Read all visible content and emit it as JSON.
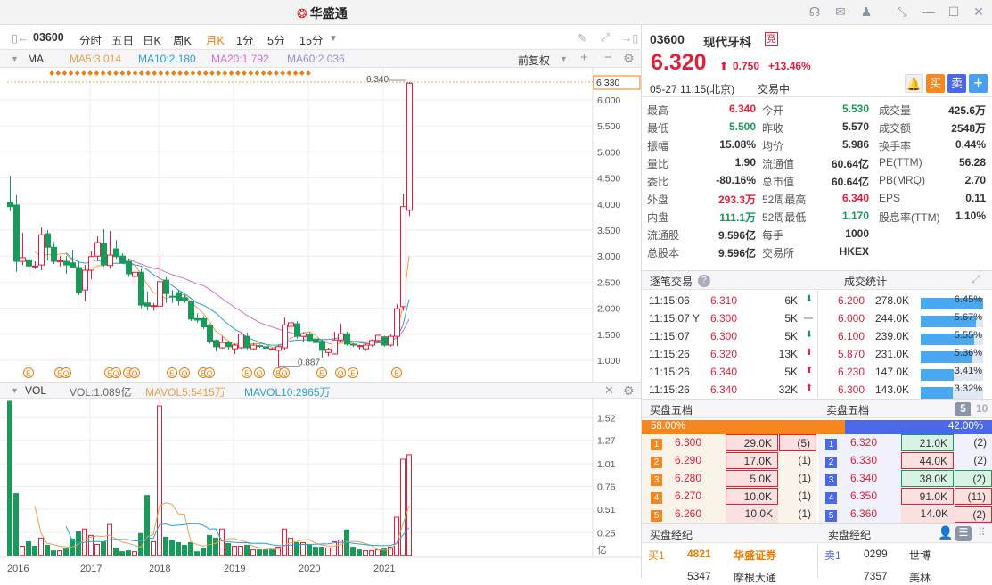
{
  "app": {
    "title": "华盛通"
  },
  "toolbar": {
    "code": "03600",
    "periods": [
      "分时",
      "五日",
      "日K",
      "周K",
      "月K",
      "1分",
      "5分",
      "15分"
    ],
    "active": "月K"
  },
  "ma": {
    "label": "MA",
    "ma5": "MA5:3.014",
    "ma10": "MA10:2.180",
    "ma20": "MA20:1.792",
    "ma60": "MA60:2.036",
    "adjust": "前复权"
  },
  "vol": {
    "label": "VOL",
    "vol": "VOL:1.089亿",
    "mavol5": "MAVOL5:5415万",
    "mavol10": "MAVOL10:2965万"
  },
  "colors": {
    "up": "#e0203a",
    "down": "#1a9a5a",
    "ma5": "#e8a04a",
    "ma10": "#2a9fd6",
    "ma20": "#d070d0",
    "ma60": "#9a8fe0",
    "accent": "#f07c00"
  },
  "chart_data": {
    "type": "candlestick",
    "price_ticks": [
      "6.000",
      "5.500",
      "5.000",
      "4.500",
      "4.000",
      "3.500",
      "3.000",
      "2.500",
      "2.000",
      "1.500",
      "1.000"
    ],
    "price_range": [
      1.0,
      6.0
    ],
    "max_label": "6.340",
    "min_label": "0.887",
    "current_label": "6.330",
    "years": [
      "2016",
      "2017",
      "2018",
      "2019",
      "2020",
      "2021"
    ],
    "year_index": [
      1,
      13,
      24,
      36,
      48,
      60
    ],
    "ohlc": [
      [
        4.03,
        4.54,
        3.86,
        3.95
      ],
      [
        3.98,
        4.17,
        2.7,
        2.9
      ],
      [
        2.9,
        3.45,
        2.83,
        2.97
      ],
      [
        2.93,
        3.14,
        2.64,
        2.81
      ],
      [
        2.81,
        2.9,
        2.75,
        2.81
      ],
      [
        2.83,
        3.55,
        2.73,
        3.41
      ],
      [
        3.43,
        3.5,
        2.92,
        3.17
      ],
      [
        3.17,
        3.27,
        2.85,
        2.9
      ],
      [
        2.89,
        3.0,
        2.8,
        2.91
      ],
      [
        2.9,
        3.0,
        2.66,
        2.83
      ],
      [
        2.87,
        3.12,
        2.78,
        2.78
      ],
      [
        2.78,
        2.9,
        2.25,
        2.3
      ],
      [
        2.35,
        2.83,
        2.13,
        2.73
      ],
      [
        2.73,
        3.09,
        2.56,
        2.99
      ],
      [
        3.0,
        3.38,
        2.9,
        3.26
      ],
      [
        3.24,
        3.52,
        2.8,
        2.83
      ],
      [
        2.82,
        3.48,
        2.76,
        3.02
      ],
      [
        3.14,
        3.31,
        2.95,
        2.99
      ],
      [
        3.0,
        3.05,
        2.85,
        2.87
      ],
      [
        2.9,
        2.95,
        2.6,
        2.66
      ],
      [
        2.61,
        2.69,
        2.44,
        2.69
      ],
      [
        2.69,
        2.75,
        2.0,
        2.06
      ],
      [
        2.1,
        2.32,
        1.96,
        2.04
      ],
      [
        2.04,
        2.1,
        1.95,
        2.05
      ],
      [
        2.04,
        3.02,
        2.0,
        2.51
      ],
      [
        2.54,
        2.6,
        2.1,
        2.28
      ],
      [
        2.23,
        2.35,
        2.1,
        2.22
      ],
      [
        2.3,
        2.35,
        2.05,
        2.15
      ],
      [
        2.2,
        2.25,
        2.1,
        2.15
      ],
      [
        2.13,
        2.15,
        1.75,
        1.79
      ],
      [
        1.8,
        1.9,
        1.72,
        1.77
      ],
      [
        1.8,
        1.85,
        1.6,
        1.64
      ],
      [
        1.67,
        1.7,
        1.32,
        1.36
      ],
      [
        1.38,
        1.4,
        1.17,
        1.26
      ],
      [
        1.24,
        1.46,
        1.22,
        1.34
      ],
      [
        1.34,
        1.38,
        1.2,
        1.26
      ],
      [
        1.22,
        1.32,
        1.12,
        1.29
      ],
      [
        1.24,
        1.52,
        1.22,
        1.5
      ],
      [
        1.46,
        1.53,
        1.21,
        1.24
      ],
      [
        1.22,
        1.33,
        1.2,
        1.29
      ],
      [
        1.28,
        1.3,
        1.24,
        1.27
      ],
      [
        1.26,
        1.28,
        1.2,
        1.23
      ],
      [
        1.22,
        1.24,
        1.2,
        1.22
      ],
      [
        1.19,
        1.3,
        0.887,
        1.26
      ],
      [
        1.24,
        1.82,
        1.2,
        1.68
      ],
      [
        1.65,
        1.75,
        1.5,
        1.72
      ],
      [
        1.7,
        1.75,
        1.42,
        1.46
      ],
      [
        1.46,
        1.54,
        1.35,
        1.51
      ],
      [
        1.5,
        1.54,
        1.36,
        1.38
      ],
      [
        1.41,
        1.45,
        1.32,
        1.34
      ],
      [
        1.36,
        1.4,
        1.05,
        1.19
      ],
      [
        1.15,
        1.24,
        1.08,
        1.21
      ],
      [
        1.12,
        1.55,
        1.12,
        1.39
      ],
      [
        1.39,
        1.7,
        1.34,
        1.51
      ],
      [
        1.51,
        1.55,
        1.28,
        1.31
      ],
      [
        1.31,
        1.33,
        1.26,
        1.29
      ],
      [
        1.28,
        1.3,
        1.21,
        1.28
      ],
      [
        1.22,
        1.32,
        1.18,
        1.29
      ],
      [
        1.29,
        1.4,
        1.26,
        1.38
      ],
      [
        1.38,
        1.49,
        1.34,
        1.48
      ],
      [
        1.45,
        1.47,
        1.26,
        1.29
      ],
      [
        1.29,
        1.5,
        1.26,
        1.46
      ],
      [
        1.46,
        2.08,
        1.27,
        1.99
      ],
      [
        2.03,
        4.2,
        1.95,
        3.95
      ],
      [
        3.88,
        6.34,
        3.77,
        6.32
      ]
    ],
    "markers": [
      [
        3,
        "E"
      ],
      [
        8,
        "E"
      ],
      [
        9,
        "Q"
      ],
      [
        16,
        "E"
      ],
      [
        17,
        "Q"
      ],
      [
        19,
        "E"
      ],
      [
        20,
        "Q"
      ],
      [
        26,
        "E"
      ],
      [
        28,
        "Q"
      ],
      [
        31,
        "E"
      ],
      [
        32,
        "Q"
      ],
      [
        38,
        "E"
      ],
      [
        40,
        "Q"
      ],
      [
        43,
        "E"
      ],
      [
        44,
        "Q"
      ],
      [
        50,
        "E"
      ],
      [
        53,
        "Q"
      ],
      [
        55,
        "E"
      ],
      [
        62,
        "E"
      ]
    ],
    "vol_ticks": [
      "1.52",
      "1.27",
      "1.01",
      "0.76",
      "0.51",
      "0.25"
    ],
    "vol_unit": "亿",
    "volume": [
      [
        1.7,
        0
      ],
      [
        0.68,
        0
      ],
      [
        0.1,
        1
      ],
      [
        0.15,
        0
      ],
      [
        0.1,
        0
      ],
      [
        0.19,
        1
      ],
      [
        0.11,
        0
      ],
      [
        0.05,
        0
      ],
      [
        0.05,
        1
      ],
      [
        0.07,
        0
      ],
      [
        0.18,
        0
      ],
      [
        0.26,
        0
      ],
      [
        0.29,
        1
      ],
      [
        0.22,
        1
      ],
      [
        0.12,
        1
      ],
      [
        0.15,
        0
      ],
      [
        0.34,
        1
      ],
      [
        0.08,
        0
      ],
      [
        0.04,
        0
      ],
      [
        0.05,
        0
      ],
      [
        0.04,
        1
      ],
      [
        0.24,
        0
      ],
      [
        0.66,
        0
      ],
      [
        0.15,
        1
      ],
      [
        1.65,
        1
      ],
      [
        0.2,
        0
      ],
      [
        0.16,
        0
      ],
      [
        0.14,
        0
      ],
      [
        0.11,
        0
      ],
      [
        0.14,
        0
      ],
      [
        0.04,
        0
      ],
      [
        0.08,
        0
      ],
      [
        0.22,
        0
      ],
      [
        0.19,
        0
      ],
      [
        0.29,
        1
      ],
      [
        0.13,
        0
      ],
      [
        0.1,
        1
      ],
      [
        0.1,
        1
      ],
      [
        0.11,
        0
      ],
      [
        0.06,
        1
      ],
      [
        0.06,
        0
      ],
      [
        0.06,
        0
      ],
      [
        0.06,
        0
      ],
      [
        0.09,
        1
      ],
      [
        0.29,
        1
      ],
      [
        0.19,
        1
      ],
      [
        0.14,
        0
      ],
      [
        0.14,
        1
      ],
      [
        0.11,
        0
      ],
      [
        0.09,
        0
      ],
      [
        0.09,
        0
      ],
      [
        0.08,
        1
      ],
      [
        0.15,
        1
      ],
      [
        0.17,
        1
      ],
      [
        0.28,
        0
      ],
      [
        0.09,
        0
      ],
      [
        0.06,
        0
      ],
      [
        0.05,
        1
      ],
      [
        0.05,
        1
      ],
      [
        0.06,
        1
      ],
      [
        0.07,
        0
      ],
      [
        0.09,
        1
      ],
      [
        0.42,
        1
      ],
      [
        1.06,
        1
      ],
      [
        1.11,
        1
      ]
    ]
  },
  "quote": {
    "code": "03600",
    "name": "现代牙科",
    "badge": "竞",
    "price": "6.320",
    "change": "0.750",
    "pct": "+13.46%",
    "time": "05-27  11:15(北京)",
    "status": "交易中",
    "buy": "买",
    "sell": "卖",
    "add": "+"
  },
  "stats": [
    [
      [
        "最高",
        "6.340",
        "red"
      ],
      [
        "今开",
        "5.530",
        "green"
      ],
      [
        "成交量",
        "425.6万",
        ""
      ]
    ],
    [
      [
        "最低",
        "5.500",
        "green"
      ],
      [
        "昨收",
        "5.570",
        ""
      ],
      [
        "成交额",
        "2548万",
        ""
      ]
    ],
    [
      [
        "振幅",
        "15.08%",
        ""
      ],
      [
        "均价",
        "5.986",
        ""
      ],
      [
        "换手率",
        "0.44%",
        ""
      ]
    ],
    [
      [
        "量比",
        "1.90",
        ""
      ],
      [
        "流通值",
        "60.64亿",
        ""
      ],
      [
        "PE(TTM)",
        "56.28",
        ""
      ]
    ],
    [
      [
        "委比",
        "-80.16%",
        ""
      ],
      [
        "总市值",
        "60.64亿",
        ""
      ],
      [
        "PB(MRQ)",
        "2.70",
        ""
      ]
    ],
    [
      [
        "外盘",
        "293.3万",
        "red"
      ],
      [
        "52周最高",
        "6.340",
        "red"
      ],
      [
        "EPS",
        "0.11",
        ""
      ]
    ],
    [
      [
        "内盘",
        "111.1万",
        "green"
      ],
      [
        "52周最低",
        "1.170",
        "green"
      ],
      [
        "股息率(TTM)",
        "1.10%",
        ""
      ]
    ],
    [
      [
        "流通股",
        "9.596亿",
        ""
      ],
      [
        "每手",
        "1000",
        ""
      ]
    ],
    [
      [
        "总股本",
        "9.596亿",
        ""
      ],
      [
        "交易所",
        "HKEX",
        ""
      ]
    ]
  ],
  "trades": {
    "title": "逐笔交易",
    "stats_title": "成交统计",
    "rows": [
      [
        "11:15:06",
        "6.310",
        "6K",
        "down"
      ],
      [
        "11:15:07 Y",
        "6.300",
        "5K",
        "flat"
      ],
      [
        "11:15:07",
        "6.300",
        "5K",
        "down"
      ],
      [
        "11:15:26",
        "6.320",
        "13K",
        "up"
      ],
      [
        "11:15:26",
        "6.340",
        "5K",
        "up"
      ],
      [
        "11:15:26",
        "6.340",
        "32K",
        "up"
      ]
    ],
    "stats": [
      [
        "6.200",
        "278.0K",
        "6.45%",
        6.45
      ],
      [
        "6.000",
        "244.0K",
        "5.67%",
        5.67
      ],
      [
        "6.100",
        "239.0K",
        "5.55%",
        5.55
      ],
      [
        "5.870",
        "231.0K",
        "5.36%",
        5.36
      ],
      [
        "6.230",
        "147.0K",
        "3.41%",
        3.41
      ],
      [
        "6.300",
        "143.0K",
        "3.32%",
        3.32
      ]
    ]
  },
  "book": {
    "bid_title": "买盘五档",
    "ask_title": "卖盘五档",
    "depth5": "5",
    "depth10": "10",
    "bid_pct": "58.00%",
    "ask_pct": "42.00%",
    "bid_ratio": 58,
    "bids": [
      [
        "1",
        "6.300",
        "29.0K",
        "(5)"
      ],
      [
        "2",
        "6.290",
        "17.0K",
        "(1)"
      ],
      [
        "3",
        "6.280",
        "5.0K",
        "(1)"
      ],
      [
        "4",
        "6.270",
        "10.0K",
        "(1)"
      ],
      [
        "5",
        "6.260",
        "10.0K",
        "(1)"
      ]
    ],
    "asks": [
      [
        "1",
        "6.320",
        "21.0K",
        "(2)"
      ],
      [
        "2",
        "6.330",
        "44.0K",
        "(2)"
      ],
      [
        "3",
        "6.340",
        "38.0K",
        "(2)"
      ],
      [
        "4",
        "6.350",
        "91.0K",
        "(11)"
      ],
      [
        "5",
        "6.360",
        "14.0K",
        "(2)"
      ]
    ]
  },
  "brokers": {
    "bid_title": "买盘经纪",
    "ask_title": "卖盘经纪",
    "bid": [
      [
        "买1",
        "4821",
        "华盛证券"
      ],
      [
        "",
        "5347",
        "摩根大通"
      ]
    ],
    "ask": [
      [
        "卖1",
        "0299",
        "世博"
      ],
      [
        "",
        "7357",
        "美林"
      ]
    ]
  }
}
